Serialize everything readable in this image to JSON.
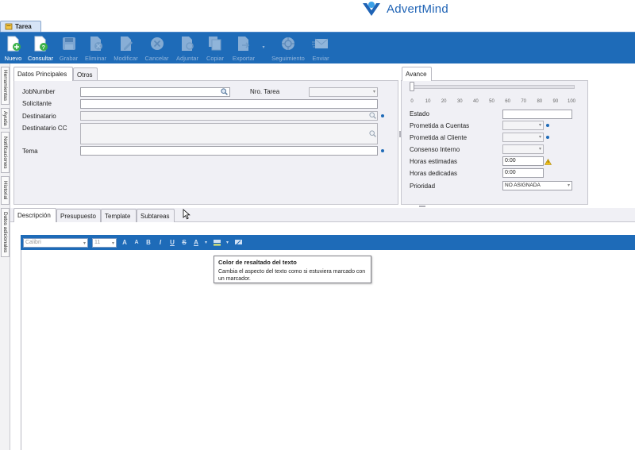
{
  "brand": {
    "name": "AdvertMind"
  },
  "document_tab": {
    "label": "Tarea"
  },
  "toolbar": {
    "buttons": [
      {
        "label": "Nuevo",
        "enabled": true,
        "icon": "new-document-icon"
      },
      {
        "label": "Consultar",
        "enabled": true,
        "icon": "query-document-icon"
      },
      {
        "label": "Grabar",
        "enabled": false,
        "icon": "save-disk-icon"
      },
      {
        "label": "Eliminar",
        "enabled": false,
        "icon": "delete-document-icon"
      },
      {
        "label": "Modificar",
        "enabled": false,
        "icon": "edit-pencil-icon"
      },
      {
        "label": "Cancelar",
        "enabled": false,
        "icon": "cancel-circle-icon"
      },
      {
        "label": "Adjuntar",
        "enabled": false,
        "icon": "attach-icon"
      },
      {
        "label": "Copiar",
        "enabled": false,
        "icon": "copy-icon"
      },
      {
        "label": "Exportar",
        "enabled": false,
        "icon": "export-icon"
      },
      {
        "label": "Seguimiento",
        "enabled": false,
        "icon": "tracking-icon"
      },
      {
        "label": "Enviar",
        "enabled": false,
        "icon": "send-mail-icon"
      }
    ]
  },
  "side_tabs": [
    "Herramientas",
    "Ayuda",
    "Notificaciones",
    "Historial",
    "Datos adicionales"
  ],
  "main_panel": {
    "tabs": [
      "Datos Principales",
      "Otros"
    ],
    "fields": {
      "jobnumber": {
        "label": "JobNumber",
        "value": ""
      },
      "nro_tarea": {
        "label": "Nro. Tarea",
        "value": ""
      },
      "solicitante": {
        "label": "Solicitante",
        "value": ""
      },
      "destinatario": {
        "label": "Destinatario",
        "value": ""
      },
      "destinatario_cc": {
        "label": "Destinatario CC",
        "value": ""
      },
      "tema": {
        "label": "Tema",
        "value": ""
      }
    }
  },
  "avance_panel": {
    "tab": "Avance",
    "progress": {
      "value": 0,
      "ticks": [
        "0",
        "10",
        "20",
        "30",
        "40",
        "50",
        "60",
        "70",
        "80",
        "90",
        "100"
      ]
    },
    "fields": {
      "estado": {
        "label": "Estado",
        "value": ""
      },
      "prometida_cuentas": {
        "label": "Prometida a Cuentas",
        "value": ""
      },
      "prometida_cliente": {
        "label": "Prometida al Cliente",
        "value": ""
      },
      "consenso_interno": {
        "label": "Consenso Interno",
        "value": ""
      },
      "horas_estimadas": {
        "label": "Horas estimadas",
        "value": "0:00"
      },
      "horas_dedicadas": {
        "label": "Horas dedicadas",
        "value": "0:00"
      },
      "prioridad": {
        "label": "Prioridad",
        "value": "NO ASIGNADA"
      }
    }
  },
  "lower_tabs": [
    "Descripción",
    "Presupuesto",
    "Template",
    "Subtareas"
  ],
  "editor": {
    "font": "Calibri",
    "size": "11",
    "accent": "#1e6bb8"
  },
  "tooltip": {
    "title": "Color de resaltado del texto",
    "body": "Cambia el aspecto del texto como si estuviera marcado con un marcador."
  },
  "colors": {
    "toolbar": "#1e6bb8",
    "panel": "#f0f0f5",
    "required_dot": "#1e6bb8"
  }
}
